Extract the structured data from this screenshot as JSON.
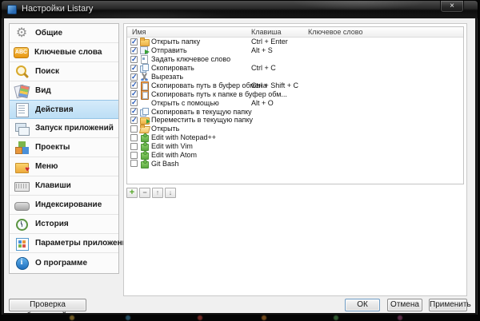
{
  "window": {
    "title": "Настройки Listary",
    "close_glyph": "×"
  },
  "sidebar": {
    "selected_index": 4,
    "items": [
      {
        "label": "Общие",
        "icon": "gear"
      },
      {
        "label": "Ключевые слова",
        "icon": "abc"
      },
      {
        "label": "Поиск",
        "icon": "search"
      },
      {
        "label": "Вид",
        "icon": "view"
      },
      {
        "label": "Действия",
        "icon": "actions"
      },
      {
        "label": "Запуск приложений",
        "icon": "launch"
      },
      {
        "label": "Проекты",
        "icon": "projects"
      },
      {
        "label": "Меню",
        "icon": "menu"
      },
      {
        "label": "Клавиши",
        "icon": "keys"
      },
      {
        "label": "Индексирование",
        "icon": "indexing"
      },
      {
        "label": "История",
        "icon": "history"
      },
      {
        "label": "Параметры приложений",
        "icon": "app-options"
      },
      {
        "label": "О программе",
        "icon": "about"
      }
    ]
  },
  "icon_glyphs": {
    "gear": "⚙",
    "abc": "ABC",
    "menu": "♥",
    "about": "i",
    "check": "✓"
  },
  "table": {
    "columns": [
      "Имя",
      "Клавиша",
      "Ключевое слово"
    ],
    "rows": [
      {
        "checked": true,
        "icon": "folder",
        "name": "Открыть папку",
        "key": "Ctrl + Enter",
        "keyword": ""
      },
      {
        "checked": true,
        "icon": "send",
        "name": "Отправить",
        "key": "Alt + S",
        "keyword": ""
      },
      {
        "checked": true,
        "icon": "keyword",
        "name": "Задать ключевое слово",
        "key": "",
        "keyword": ""
      },
      {
        "checked": true,
        "icon": "copy",
        "name": "Скопировать",
        "key": "Ctrl + C",
        "keyword": ""
      },
      {
        "checked": true,
        "icon": "cut",
        "name": "Вырезать",
        "key": "",
        "keyword": ""
      },
      {
        "checked": true,
        "icon": "clipboard",
        "name": "Скопировать путь в буфер обмена",
        "key": "Ctrl + Shift + C",
        "keyword": ""
      },
      {
        "checked": true,
        "icon": "clipboard",
        "name": "Скопировать путь к папке в буфер обм...",
        "key": "",
        "keyword": ""
      },
      {
        "checked": true,
        "icon": "none",
        "name": "Открыть с помощью",
        "key": "Alt + O",
        "keyword": ""
      },
      {
        "checked": true,
        "icon": "copy",
        "name": "Скопировать в текущую папку",
        "key": "",
        "keyword": ""
      },
      {
        "checked": true,
        "icon": "move",
        "name": "Переместить в текущую папку",
        "key": "",
        "keyword": ""
      },
      {
        "checked": false,
        "icon": "folder-open",
        "name": "Открыть",
        "key": "",
        "keyword": ""
      },
      {
        "checked": false,
        "icon": "puzzle",
        "name": "Edit with Notepad++",
        "key": "",
        "keyword": ""
      },
      {
        "checked": false,
        "icon": "puzzle",
        "name": "Edit with Vim",
        "key": "",
        "keyword": ""
      },
      {
        "checked": false,
        "icon": "puzzle",
        "name": "Edit with Atom",
        "key": "",
        "keyword": ""
      },
      {
        "checked": false,
        "icon": "puzzle",
        "name": "Git Bash",
        "key": "",
        "keyword": ""
      }
    ]
  },
  "toolbar": {
    "buttons": [
      {
        "name": "add",
        "glyph": "+"
      },
      {
        "name": "remove",
        "glyph": "−"
      },
      {
        "name": "move-up",
        "glyph": "↑"
      },
      {
        "name": "move-down",
        "glyph": "↓"
      }
    ]
  },
  "footer": {
    "update": "Проверка обновлений...",
    "ok": "ОК",
    "cancel": "Отмена",
    "apply": "Применить"
  },
  "colors": {
    "selected_bg": "#c8e4f8",
    "selected_border": "#96c4e6",
    "client_bg": "#f0f0f0",
    "titlebar": "#1d1d1d",
    "check": "#2458b8"
  }
}
